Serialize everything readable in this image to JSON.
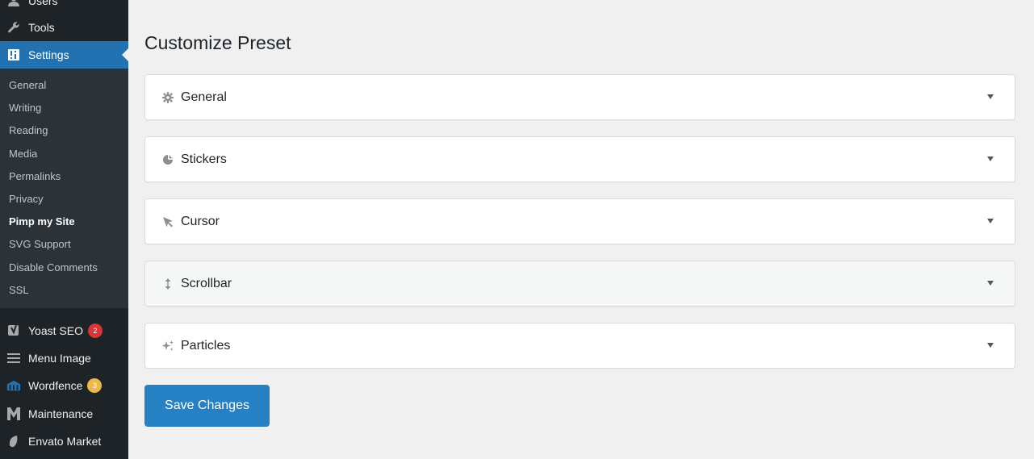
{
  "sidebar": {
    "top_items": [
      {
        "label": "Users",
        "icon": "users-icon"
      },
      {
        "label": "Tools",
        "icon": "wrench-icon"
      },
      {
        "label": "Settings",
        "icon": "settings-icon"
      }
    ],
    "submenu": [
      "General",
      "Writing",
      "Reading",
      "Media",
      "Permalinks",
      "Privacy",
      "Pimp my Site",
      "SVG Support",
      "Disable Comments",
      "SSL"
    ],
    "current_submenu": "Pimp my Site",
    "bottom_items": [
      {
        "label": "Yoast SEO",
        "icon": "yoast-icon",
        "badge": "2",
        "badge_color": "#d63638"
      },
      {
        "label": "Menu Image",
        "icon": "menu-lines-icon"
      },
      {
        "label": "Wordfence",
        "icon": "wordfence-icon",
        "badge": "3",
        "badge_color": "#f0b849"
      },
      {
        "label": "Maintenance",
        "icon": "maintenance-m-icon"
      },
      {
        "label": "Envato Market",
        "icon": "envato-leaf-icon"
      }
    ]
  },
  "main": {
    "title": "Customize Preset",
    "panels": [
      {
        "label": "General",
        "icon": "gear-icon"
      },
      {
        "label": "Stickers",
        "icon": "sticker-icon"
      },
      {
        "label": "Cursor",
        "icon": "cursor-icon"
      },
      {
        "label": "Scrollbar",
        "icon": "vertical-arrows-icon"
      },
      {
        "label": "Particles",
        "icon": "sparkles-icon"
      }
    ],
    "save_label": "Save Changes"
  },
  "colors": {
    "accent": "#2271b1",
    "sidebar_bg": "#1d2327",
    "submenu_bg": "#2c3338",
    "button": "#2681c4"
  }
}
